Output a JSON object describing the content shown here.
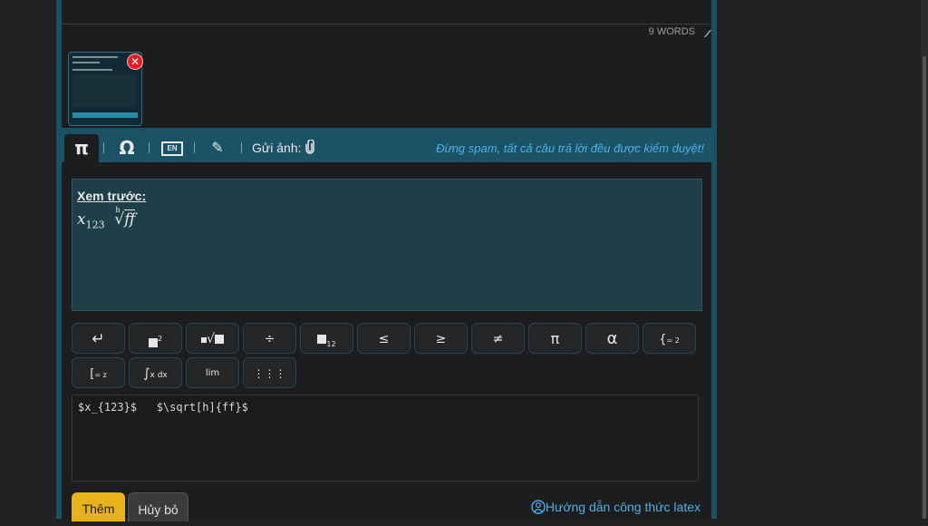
{
  "editor": {
    "word_count": "9 WORDS"
  },
  "attachment": {
    "remove_symbol": "✕"
  },
  "toolbar": {
    "tabs": [
      {
        "symbol": "π"
      },
      {
        "symbol": "Ω"
      },
      {
        "symbol": "EN"
      },
      {
        "symbol": "✎"
      }
    ],
    "send_image_label": "Gửi ảnh:",
    "notice": "Đừng spam, tất cả câu trả lời đều được kiểm duyệt!"
  },
  "preview": {
    "title": "Xem trước:",
    "math_var": "x",
    "math_sub": "123",
    "root_index": "h",
    "root_body": "ff"
  },
  "math_buttons": {
    "row1": [
      {
        "label": "↵"
      },
      {
        "label": "2"
      },
      {
        "label": "√"
      },
      {
        "label": "÷"
      },
      {
        "label": "12"
      },
      {
        "label": "≤"
      },
      {
        "label": "≥"
      },
      {
        "label": "≠"
      },
      {
        "label": "π"
      },
      {
        "label": "α"
      },
      {
        "label": "= 2"
      }
    ],
    "row2": [
      {
        "label": "= z"
      },
      {
        "label": "x dx"
      },
      {
        "label": "lim"
      },
      {
        "label": "⋮⋮⋮"
      }
    ]
  },
  "latex_input": {
    "value": "$x_{123}$   $\\sqrt[h]{ff}$"
  },
  "actions": {
    "add_label": "Thêm",
    "cancel_label": "Hủy bỏ",
    "guide_label": "Hướng dẫn công thức latex"
  },
  "colors": {
    "accent": "#1c5266",
    "link": "#4fb0e8",
    "add_button": "#e8b31a",
    "remove": "#e02020"
  }
}
